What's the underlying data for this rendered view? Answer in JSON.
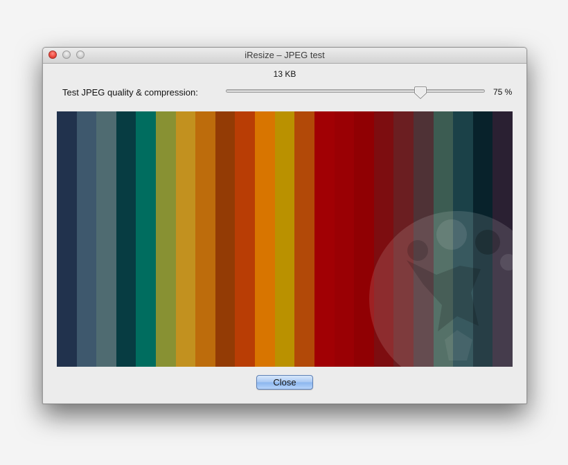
{
  "window": {
    "title": "iResize – JPEG test"
  },
  "preview": {
    "file_size": "13 KB",
    "stripe_colors": [
      "#21324d",
      "#3e586d",
      "#4f6b71",
      "#073c42",
      "#006d5f",
      "#889133",
      "#c2911f",
      "#bd6c0c",
      "#933b05",
      "#b93d05",
      "#d87500",
      "#ba9100",
      "#b24908",
      "#a10004",
      "#9a0004",
      "#900003",
      "#7d0d10",
      "#6b1e21",
      "#4f3236",
      "#3c5c52",
      "#1b4148",
      "#08222b",
      "#2a2032"
    ]
  },
  "quality": {
    "label": "Test JPEG quality & compression:",
    "value": 75,
    "value_text": "75 %"
  },
  "buttons": {
    "close_label": "Close"
  },
  "colors": {
    "close_traffic_light": "#ee4b40",
    "default_button": "#a9c8f2"
  }
}
